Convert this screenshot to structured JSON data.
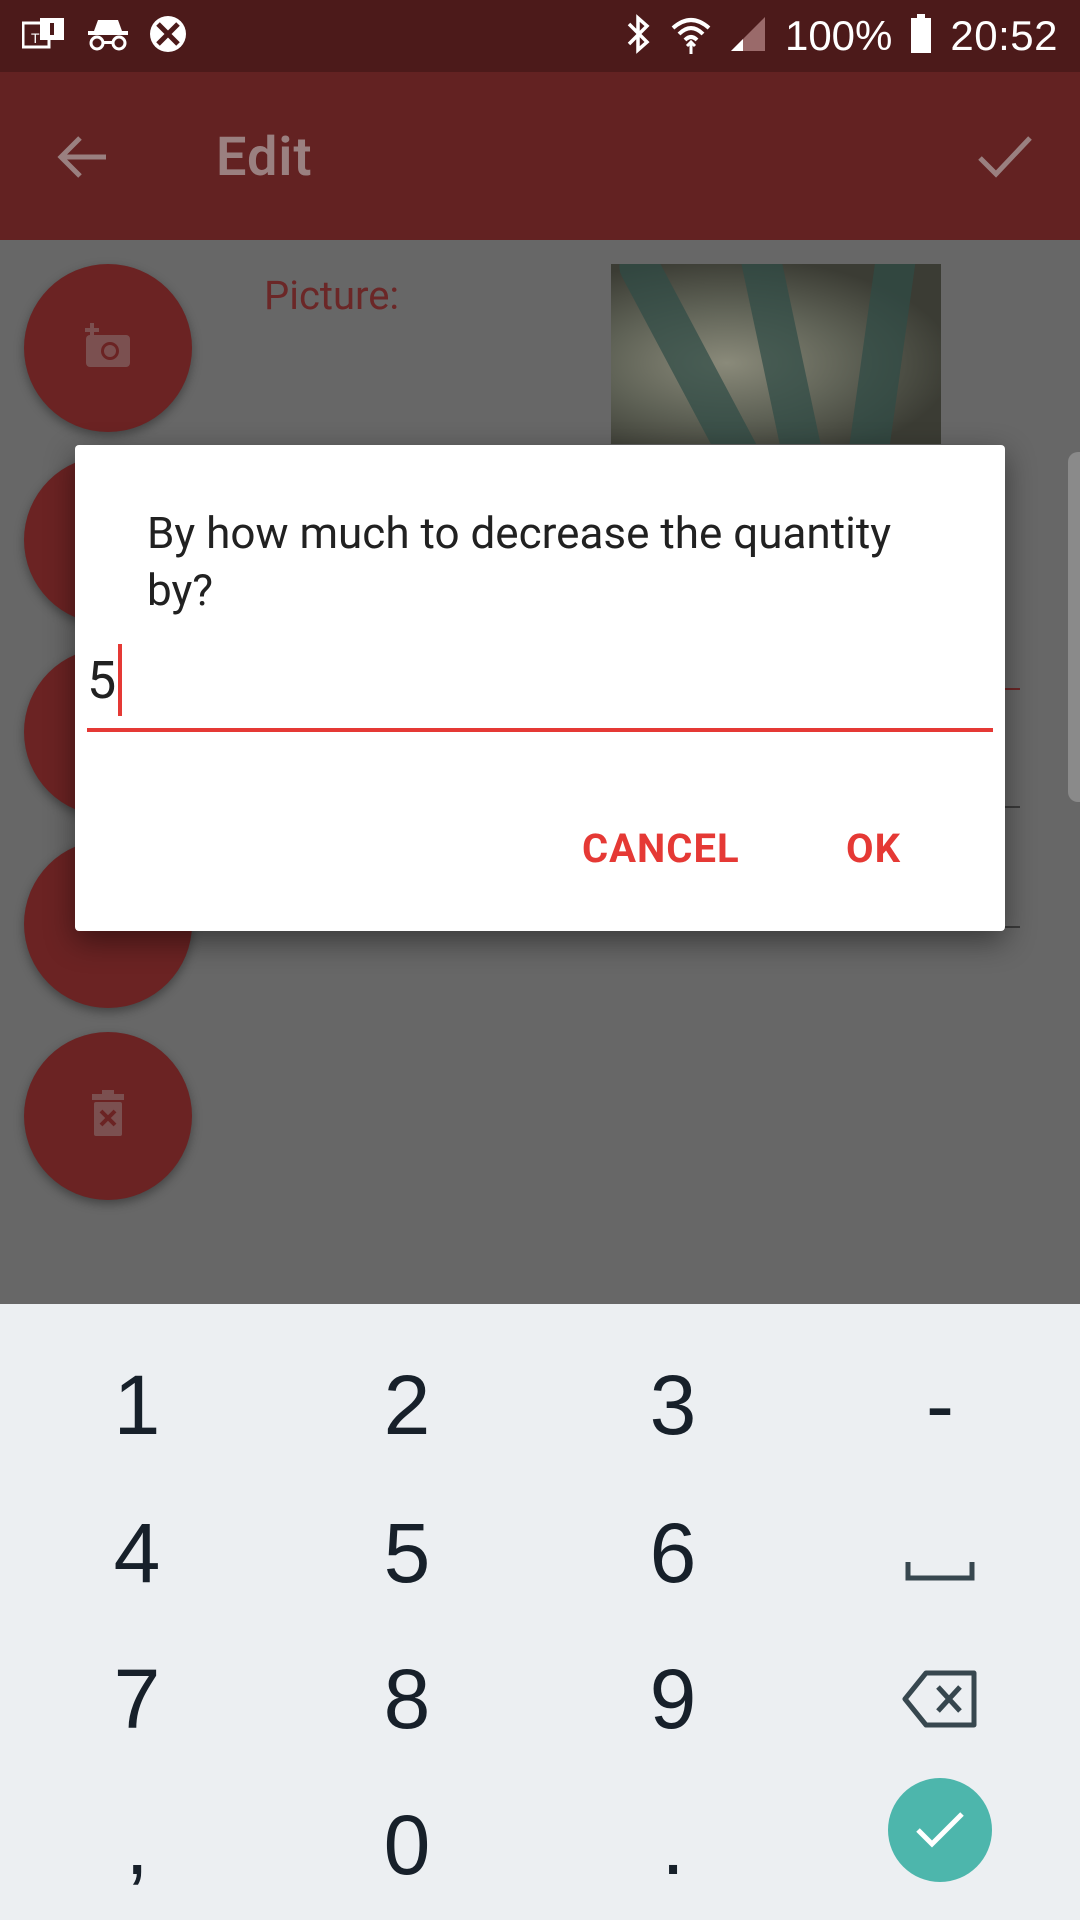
{
  "status_bar": {
    "battery": "100%",
    "time": "20:52",
    "icons": [
      "teams-icon",
      "incognito-icon",
      "blocked-app-icon",
      "bluetooth-icon",
      "wifi-icon",
      "signal-icon",
      "battery-icon"
    ]
  },
  "app_bar": {
    "title": "Edit",
    "back_icon": "arrow-back-icon",
    "confirm_icon": "check-icon",
    "background": "#632222"
  },
  "content": {
    "picture_label": "Picture:",
    "fabs": [
      "add-photo-icon",
      "fab-2",
      "fab-3",
      "tag-icon",
      "delete-icon"
    ]
  },
  "dialog": {
    "message": "By how much to decrease the quantity by?",
    "input_value": "5",
    "cancel_label": "CANCEL",
    "ok_label": "OK",
    "accent": "#e53935"
  },
  "keyboard": {
    "rows": [
      [
        "1",
        "2",
        "3",
        "-"
      ],
      [
        "4",
        "5",
        "6",
        "space"
      ],
      [
        "7",
        "8",
        "9",
        "backspace"
      ],
      [
        ",",
        "0",
        ".",
        "enter"
      ]
    ],
    "enter_color": "#4db6ac"
  }
}
